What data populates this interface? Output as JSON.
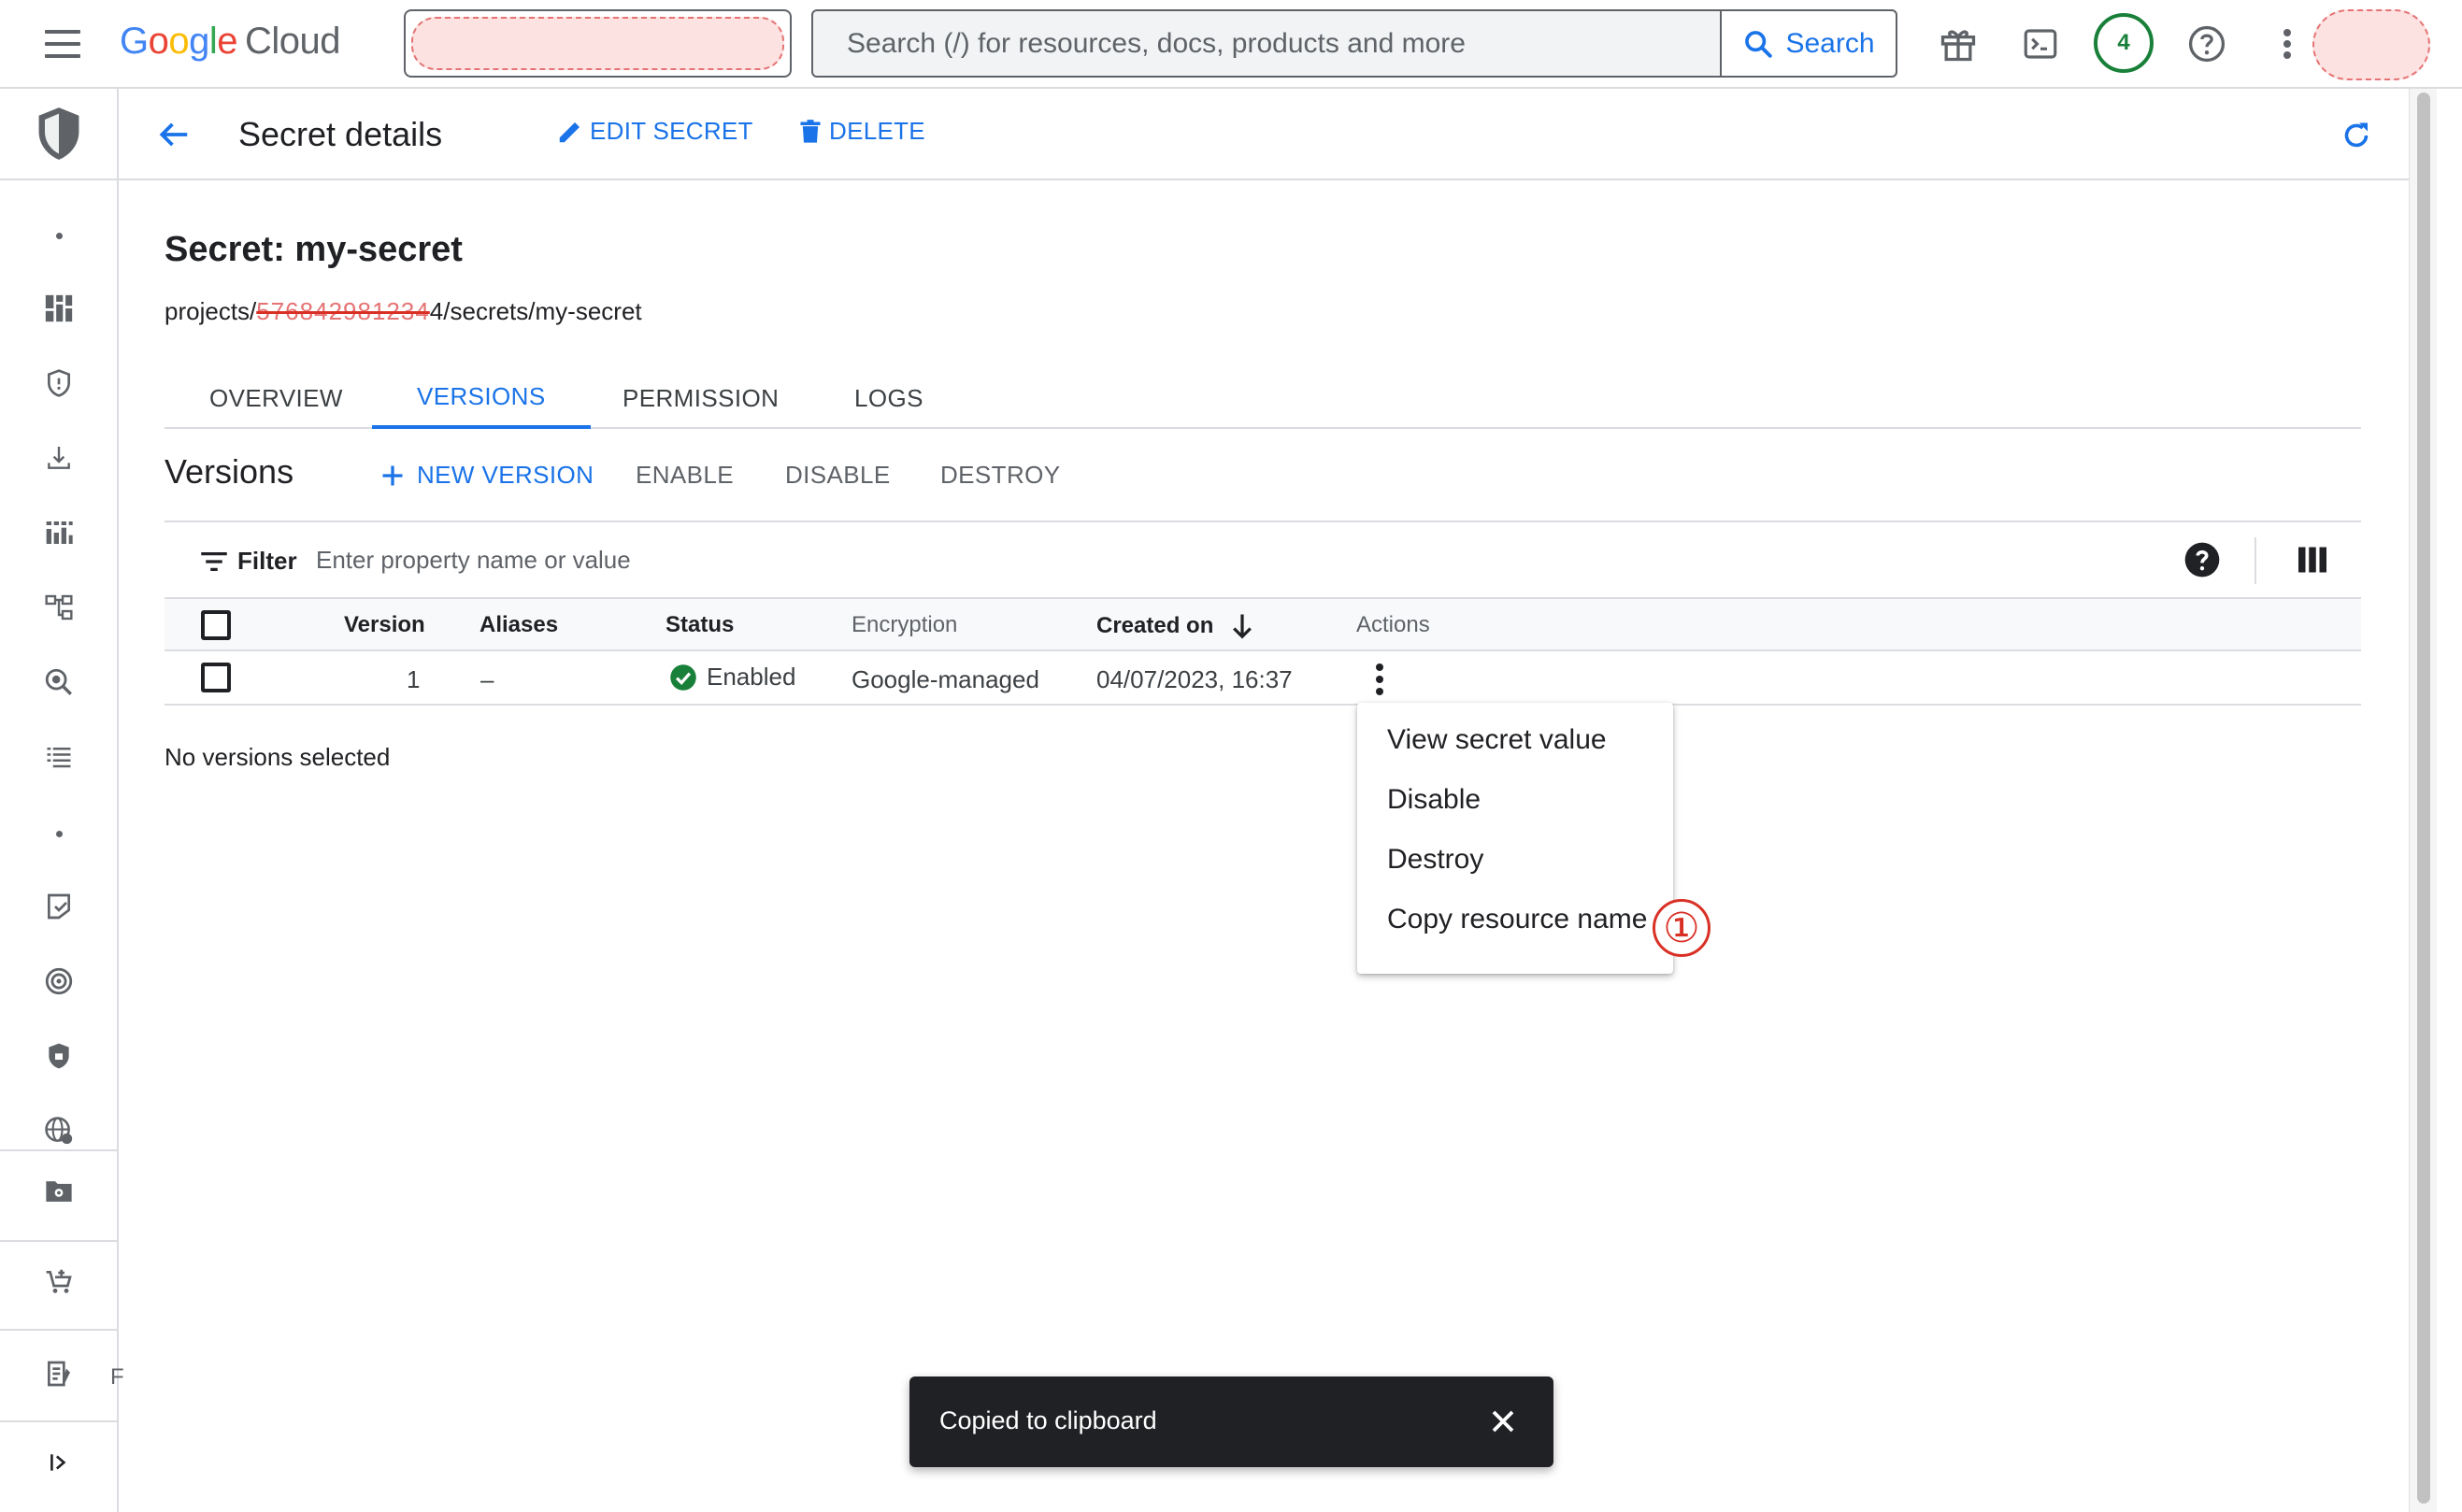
{
  "topbar": {
    "logo_letters": [
      "G",
      "o",
      "o",
      "g",
      "l",
      "e"
    ],
    "logo_product": "Cloud",
    "search_placeholder": "Search (/) for resources, docs, products and more",
    "search_button": "Search",
    "notification_count": "4",
    "icons": [
      "menu-icon",
      "gift-icon",
      "terminal-icon",
      "help-circle-icon",
      "more-vert-icon"
    ]
  },
  "header": {
    "title": "Secret details",
    "edit_label": "EDIT SECRET",
    "delete_label": "DELETE"
  },
  "secret": {
    "title": "Secret: my-secret",
    "path_prefix": "projects/",
    "path_redacted": "576842981234",
    "path_suffix": "4/secrets/my-secret"
  },
  "tabs": [
    {
      "label": "OVERVIEW",
      "active": false
    },
    {
      "label": "VERSIONS",
      "active": true
    },
    {
      "label": "PERMISSION",
      "active": false
    },
    {
      "label": "LOGS",
      "active": false
    }
  ],
  "versions": {
    "title": "Versions",
    "new_version": "NEW VERSION",
    "enable": "ENABLE",
    "disable": "DISABLE",
    "destroy": "DESTROY"
  },
  "filter": {
    "label": "Filter",
    "placeholder": "Enter property name or value"
  },
  "table": {
    "columns": [
      "Version",
      "Aliases",
      "Status",
      "Encryption",
      "Created on",
      "Actions"
    ],
    "rows": [
      {
        "version": "1",
        "aliases": "–",
        "status": "Enabled",
        "encryption": "Google-managed",
        "created_on": "04/07/2023, 16:37"
      }
    ]
  },
  "selection_text": "No versions selected",
  "actions_menu": {
    "items": [
      "View secret value",
      "Disable",
      "Destroy",
      "Copy resource name"
    ],
    "marker": "①"
  },
  "snackbar": {
    "message": "Copied to clipboard"
  },
  "sidebar": {
    "partial_label": "F"
  },
  "colors": {
    "accent": "#1a73e8",
    "success": "#188038",
    "marker": "#d93025"
  }
}
